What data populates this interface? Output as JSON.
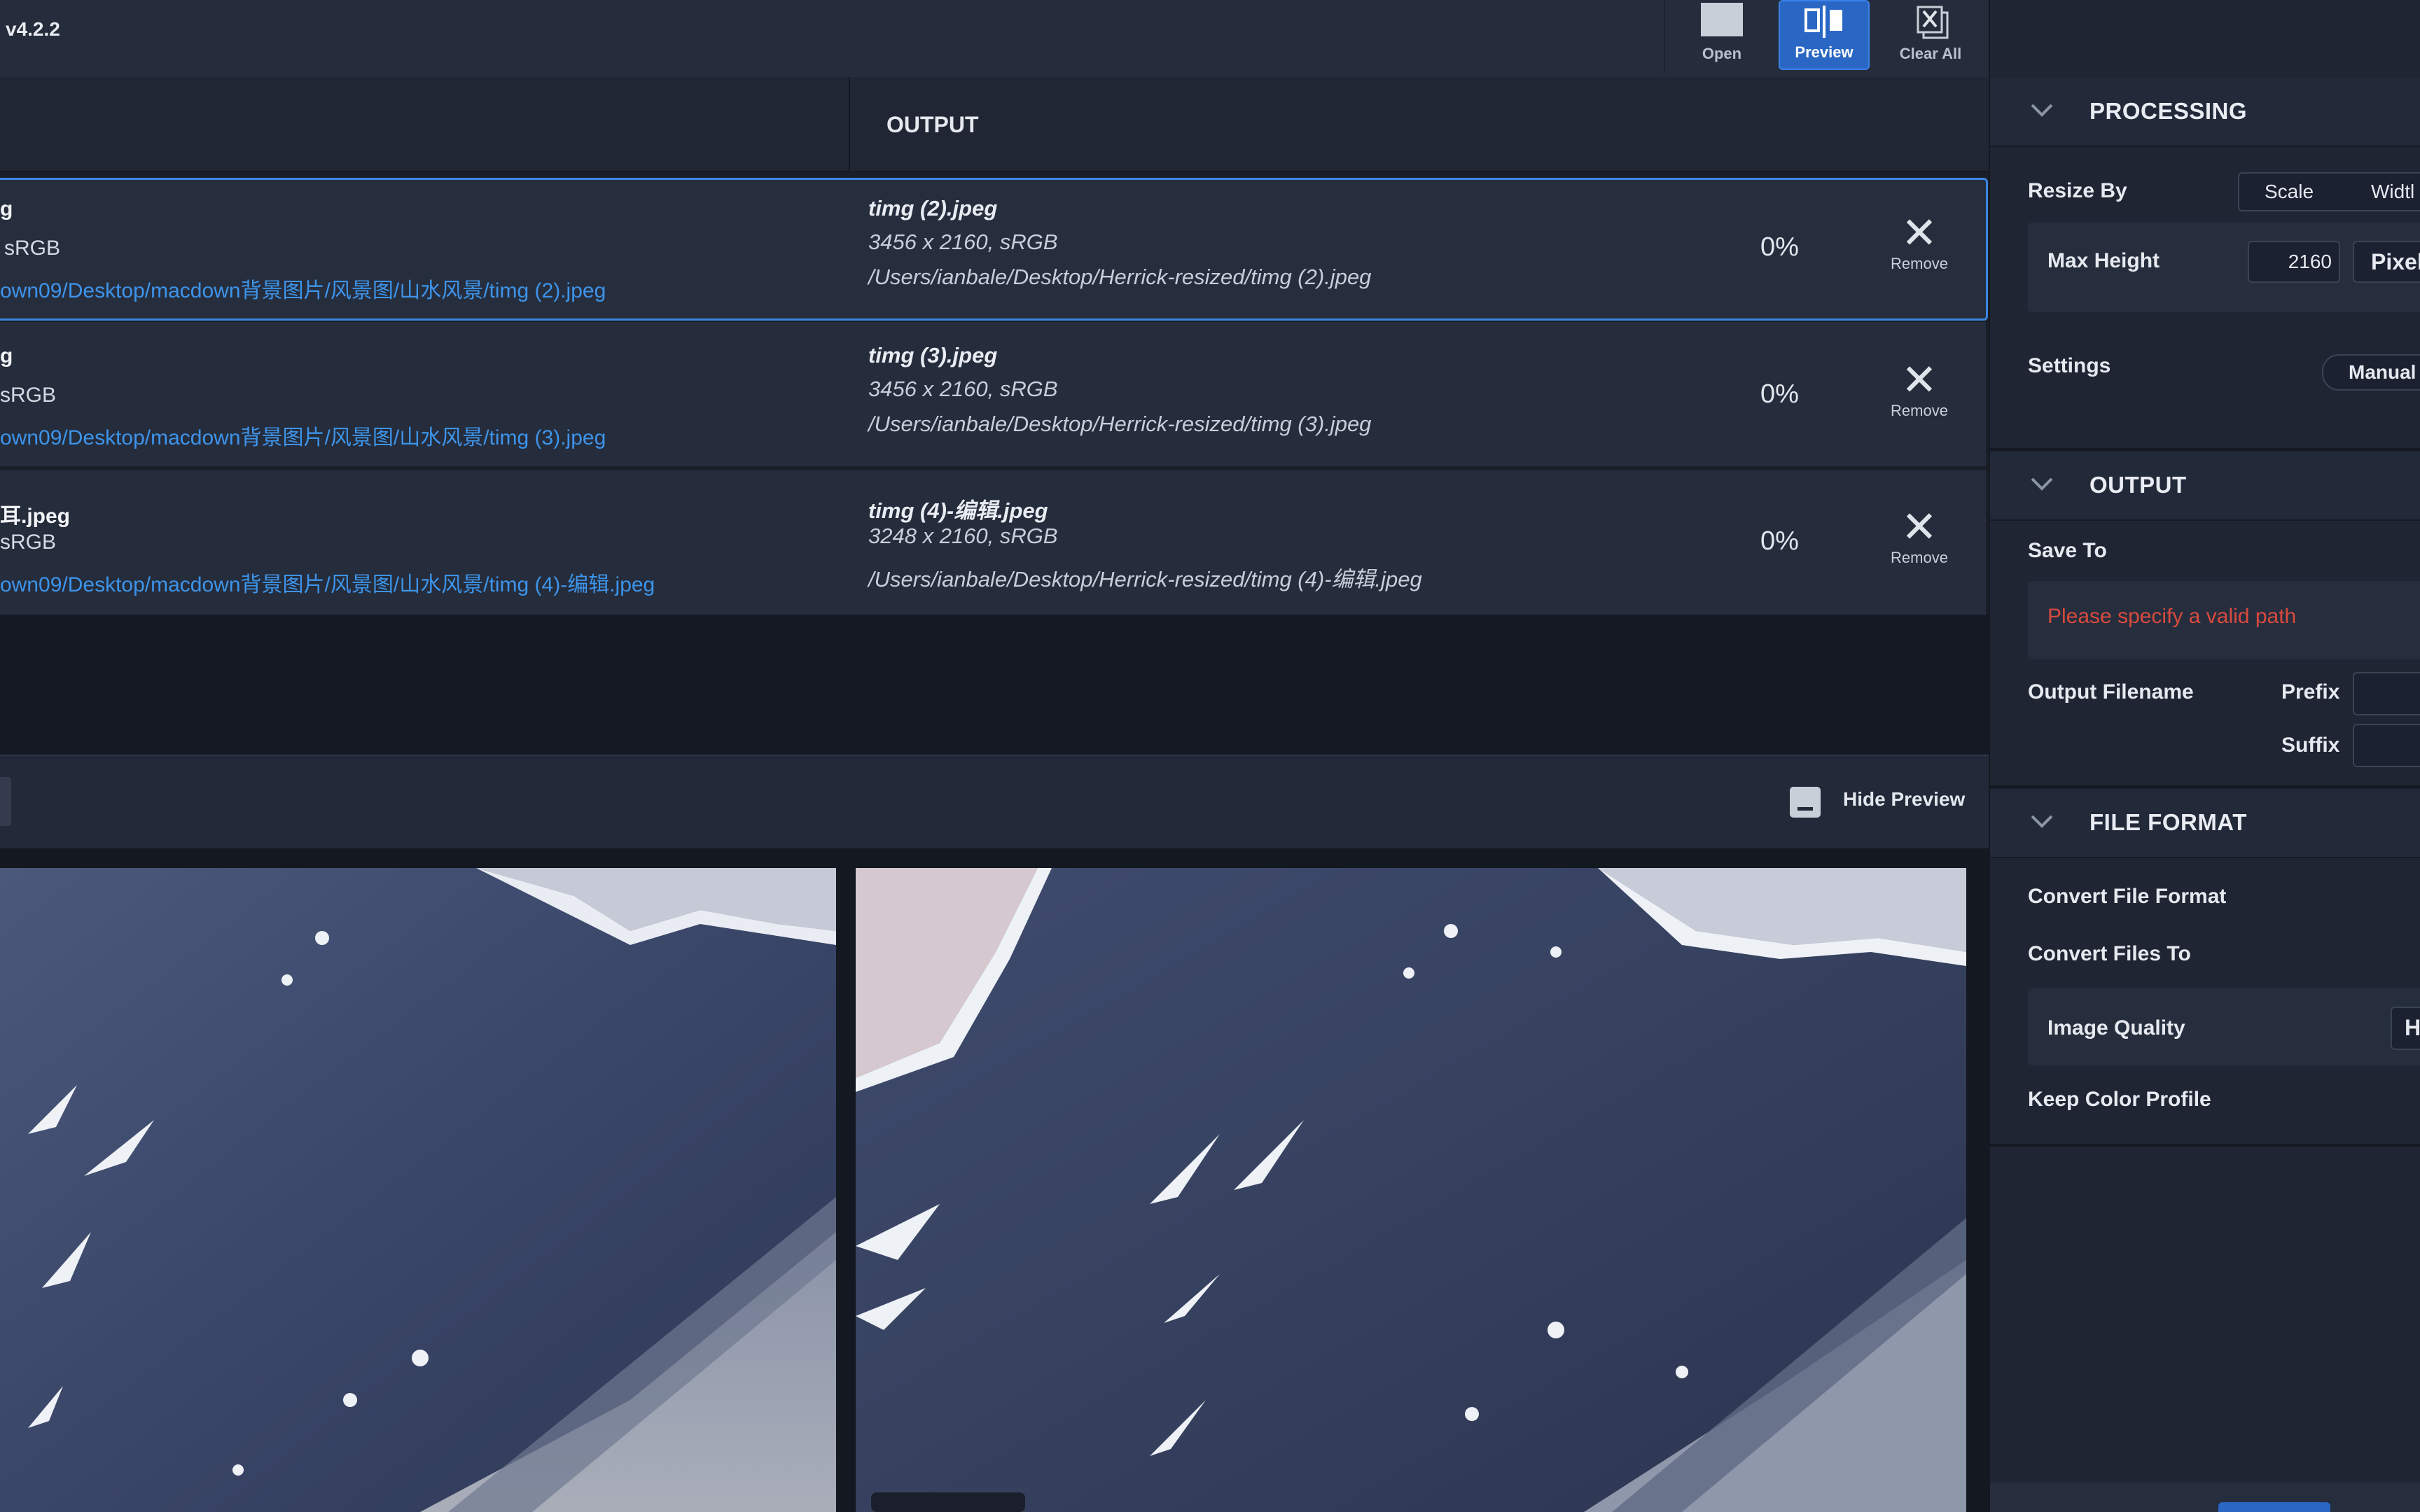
{
  "app": {
    "version": "v4.2.2"
  },
  "toolbar": {
    "open_label": "Open",
    "preview_label": "Preview",
    "clear_label": "Clear All"
  },
  "list": {
    "output_header": "OUTPUT",
    "remove_label": "Remove",
    "rows": [
      {
        "input_name": "g",
        "input_meta": "sRGB",
        "input_path": "own09/Desktop/macdown背景图片/风景图/山水风景/timg (2).jpeg",
        "output_name": "timg (2).jpeg",
        "output_meta": "3456 x 2160, sRGB",
        "output_path": "/Users/ianbale/Desktop/Herrick-resized/timg (2).jpeg",
        "progress": "0%",
        "selected": true
      },
      {
        "input_name": "g",
        "input_meta": "sRGB",
        "input_path": "own09/Desktop/macdown背景图片/风景图/山水风景/timg (3).jpeg",
        "output_name": "timg (3).jpeg",
        "output_meta": "3456 x 2160, sRGB",
        "output_path": "/Users/ianbale/Desktop/Herrick-resized/timg (3).jpeg",
        "progress": "0%",
        "selected": false
      },
      {
        "input_name": "耳.jpeg",
        "input_meta": "sRGB",
        "input_path": "own09/Desktop/macdown背景图片/风景图/山水风景/timg (4)-编辑.jpeg",
        "output_name": "timg (4)-编辑.jpeg",
        "output_meta": "3248 x 2160, sRGB",
        "output_path": "/Users/ianbale/Desktop/Herrick-resized/timg (4)-编辑.jpeg",
        "progress": "0%",
        "selected": false
      }
    ]
  },
  "preview": {
    "hide_label": "Hide Preview"
  },
  "panel": {
    "processing": {
      "title": "PROCESSING",
      "resize_by_label": "Resize By",
      "resize_options": [
        "Scale",
        "Widtl"
      ],
      "max_height_label": "Max Height",
      "max_height_value": "2160",
      "unit": "Pixel",
      "settings_label": "Settings",
      "settings_value": "Manual"
    },
    "output": {
      "title": "OUTPUT",
      "save_to_label": "Save To",
      "save_to_error": "Please specify a valid path",
      "filename_label": "Output Filename",
      "prefix_label": "Prefix",
      "suffix_label": "Suffix"
    },
    "file_format": {
      "title": "FILE FORMAT",
      "convert_format_label": "Convert File Format",
      "convert_to_label": "Convert Files To",
      "quality_label": "Image Quality",
      "quality_value": "H",
      "keep_profile_label": "Keep Color Profile"
    }
  },
  "colors": {
    "accent": "#2a67c4",
    "link": "#3d94ea",
    "error": "#d94a3e",
    "selection_border": "#3a86e0"
  }
}
